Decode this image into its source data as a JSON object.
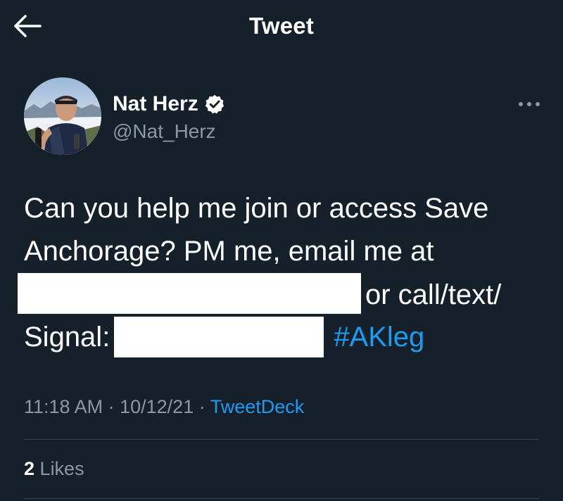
{
  "header": {
    "title": "Tweet",
    "back_icon": "arrow-left-icon"
  },
  "author": {
    "display_name": "Nat Herz",
    "handle": "@Nat_Herz",
    "verified": true,
    "more_icon": "more-horizontal-icon"
  },
  "tweet": {
    "line1": "Can you help me join or access Save",
    "line2": "Anchorage? PM me, email me at",
    "line3_after_redaction": "or call/text/",
    "line4_prefix": "Signal:",
    "hashtag": "#AKleg"
  },
  "meta": {
    "time": "11:18 AM",
    "separator": "·",
    "date": "10/12/21",
    "source": "TweetDeck"
  },
  "stats": {
    "likes_count": "2",
    "likes_label": "Likes"
  },
  "colors": {
    "background": "#15202b",
    "link": "#1d9bf0",
    "secondary_text": "#8b98a5",
    "divider": "#38444d"
  }
}
